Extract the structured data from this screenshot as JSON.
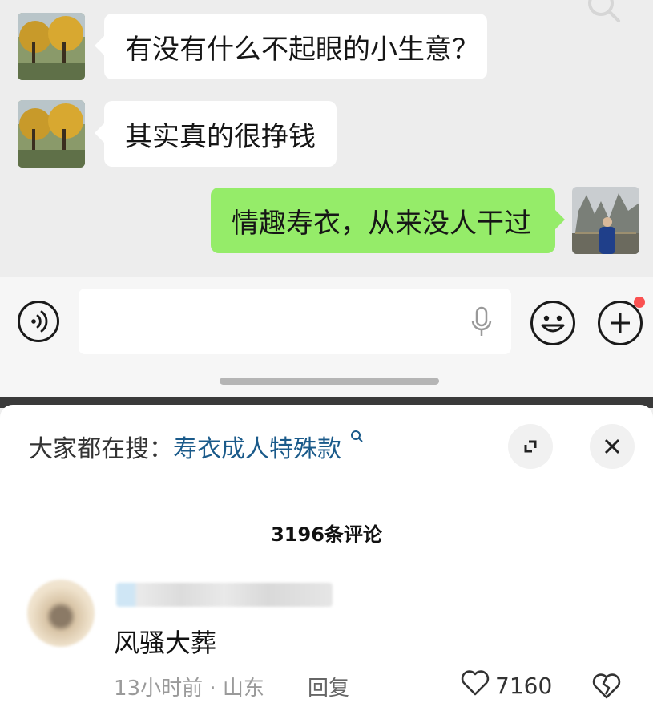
{
  "chat": {
    "messages": [
      {
        "side": "left",
        "text": "有没有什么不起眼的小生意？"
      },
      {
        "side": "left",
        "text": "其实真的很挣钱"
      },
      {
        "side": "right",
        "text": "情趣寿衣，从来没人干过"
      }
    ]
  },
  "input_bar": {
    "icons": [
      "voice-icon",
      "microphone-icon",
      "emoji-icon",
      "plus-icon"
    ],
    "plus_has_red_dot": true
  },
  "comment_sheet": {
    "hot_search_prefix": "大家都在搜：",
    "hot_search_term": "寿衣成人特殊款",
    "comment_count": "3196条评论",
    "comment": {
      "text": "风骚大葬",
      "meta": "13小时前 · 山东",
      "reply_label": "回复",
      "likes": "7160"
    }
  },
  "colors": {
    "outgoing_bubble": "#95ec69",
    "incoming_bubble": "#ffffff",
    "link": "#1a5a8a",
    "red_dot": "#fa5151"
  }
}
